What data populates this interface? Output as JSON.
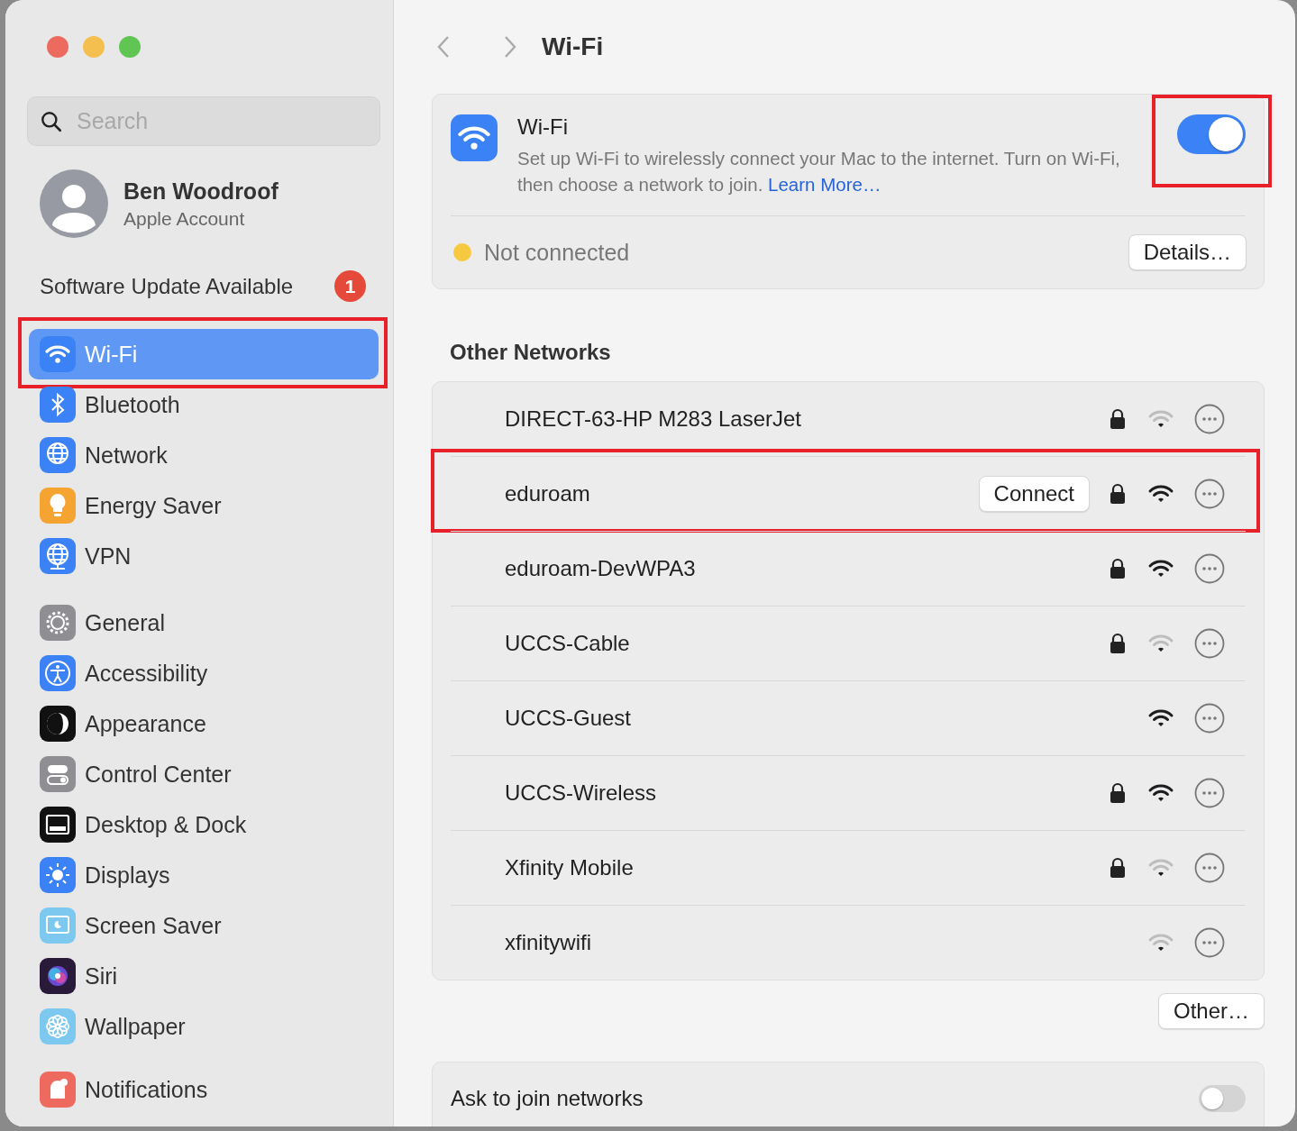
{
  "sidebar": {
    "search": {
      "placeholder": "Search"
    },
    "account": {
      "name": "Ben Woodroof",
      "subtitle": "Apple Account"
    },
    "update": {
      "label": "Software Update Available",
      "badge": "1"
    },
    "groups": [
      {
        "items": [
          {
            "label": "Wi-Fi",
            "selected": true,
            "highlighted": true
          },
          {
            "label": "Bluetooth",
            "selected": false,
            "highlighted": false
          },
          {
            "label": "Network",
            "selected": false,
            "highlighted": false
          },
          {
            "label": "Energy Saver",
            "selected": false,
            "highlighted": false
          },
          {
            "label": "VPN",
            "selected": false,
            "highlighted": false
          }
        ]
      },
      {
        "items": [
          {
            "label": "General",
            "selected": false,
            "highlighted": false
          },
          {
            "label": "Accessibility",
            "selected": false,
            "highlighted": false
          },
          {
            "label": "Appearance",
            "selected": false,
            "highlighted": false
          },
          {
            "label": "Control Center",
            "selected": false,
            "highlighted": false
          },
          {
            "label": "Desktop & Dock",
            "selected": false,
            "highlighted": false
          },
          {
            "label": "Displays",
            "selected": false,
            "highlighted": false
          },
          {
            "label": "Screen Saver",
            "selected": false,
            "highlighted": false
          },
          {
            "label": "Siri",
            "selected": false,
            "highlighted": false
          },
          {
            "label": "Wallpaper",
            "selected": false,
            "highlighted": false
          }
        ]
      },
      {
        "items": [
          {
            "label": "Notifications",
            "selected": false,
            "highlighted": false
          }
        ]
      }
    ]
  },
  "header": {
    "title": "Wi-Fi"
  },
  "wifi_card": {
    "title": "Wi-Fi",
    "description": "Set up Wi-Fi to wirelessly connect your Mac to the internet. Turn on Wi-Fi, then choose a network to join.",
    "link": "Learn More…",
    "on": true,
    "toggle_highlighted": true,
    "connected": false,
    "status": "Not connected",
    "details_button": "Details…"
  },
  "other_networks": {
    "heading": "Other Networks",
    "networks": [
      {
        "name": "DIRECT-63-HP M283 LaserJet",
        "locked": true,
        "strong_signal": false,
        "highlighted": false
      },
      {
        "name": "eduroam",
        "connect_button": "Connect",
        "locked": true,
        "strong_signal": true,
        "highlighted": true
      },
      {
        "name": "eduroam-DevWPA3",
        "locked": true,
        "strong_signal": true,
        "highlighted": false
      },
      {
        "name": "UCCS-Cable",
        "locked": true,
        "strong_signal": false,
        "highlighted": false
      },
      {
        "name": "UCCS-Guest",
        "locked": false,
        "strong_signal": true,
        "highlighted": false
      },
      {
        "name": "UCCS-Wireless",
        "locked": true,
        "strong_signal": true,
        "highlighted": false
      },
      {
        "name": "Xfinity Mobile",
        "locked": true,
        "strong_signal": false,
        "highlighted": false
      },
      {
        "name": "xfinitywifi",
        "locked": false,
        "strong_signal": false,
        "highlighted": false
      }
    ]
  },
  "other_button": "Other…",
  "ask_to_join": {
    "label": "Ask to join networks",
    "on": false
  }
}
